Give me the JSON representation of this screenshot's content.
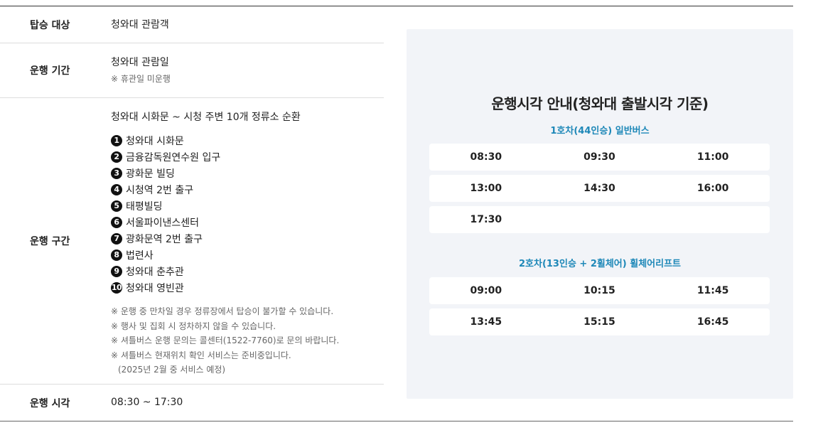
{
  "info": {
    "target": {
      "label": "탑승 대상",
      "value": "청와대 관람객"
    },
    "period": {
      "label": "운행 기간",
      "value": "청와대 관람일",
      "note": "※ 휴관일 미운행"
    },
    "route": {
      "label": "운행 구간",
      "summary": "청와대 시화문 ~ 시청 주변 10개 정류소 순환",
      "stops": [
        {
          "num": "1",
          "name": "청와대 시화문"
        },
        {
          "num": "2",
          "name": "금융감독원연수원 입구"
        },
        {
          "num": "3",
          "name": "광화문 빌딩"
        },
        {
          "num": "4",
          "name": "시청역 2번 출구"
        },
        {
          "num": "5",
          "name": "태평빌딩"
        },
        {
          "num": "6",
          "name": "서울파이낸스센터"
        },
        {
          "num": "7",
          "name": "광화문역 2번 출구"
        },
        {
          "num": "8",
          "name": "법련사"
        },
        {
          "num": "9",
          "name": "청와대 춘추관"
        },
        {
          "num": "10",
          "name": "청와대 영빈관"
        }
      ],
      "notes": [
        "※ 운행 중 만차일 경우 정류장에서 탑승이 불가할 수 있습니다.",
        "※ 행사 및 집회 시 정차하지 않을 수 있습니다.",
        "※ 셔틀버스 운행 문의는 콜센터(1522-7760)로 문의 바랍니다.",
        "※ 셔틀버스 현재위치 확인 서비스는 준비중입니다.",
        "(2025년 2월 중 서비스 예정)"
      ]
    },
    "time": {
      "label": "운행 시각",
      "value": "08:30 ~ 17:30"
    }
  },
  "schedule": {
    "title": "운행시각 안내(청와대 출발시각 기준)",
    "bus1": {
      "title": "1호차(44인승) 일반버스",
      "rows": [
        [
          "08:30",
          "09:30",
          "11:00"
        ],
        [
          "13:00",
          "14:30",
          "16:00"
        ],
        [
          "17:30",
          "",
          ""
        ]
      ]
    },
    "bus2": {
      "title": "2호차(13인승 + 2휠체어) 휠체어리프트",
      "rows": [
        [
          "09:00",
          "10:15",
          "11:45"
        ],
        [
          "13:45",
          "15:15",
          "16:45"
        ]
      ]
    }
  }
}
